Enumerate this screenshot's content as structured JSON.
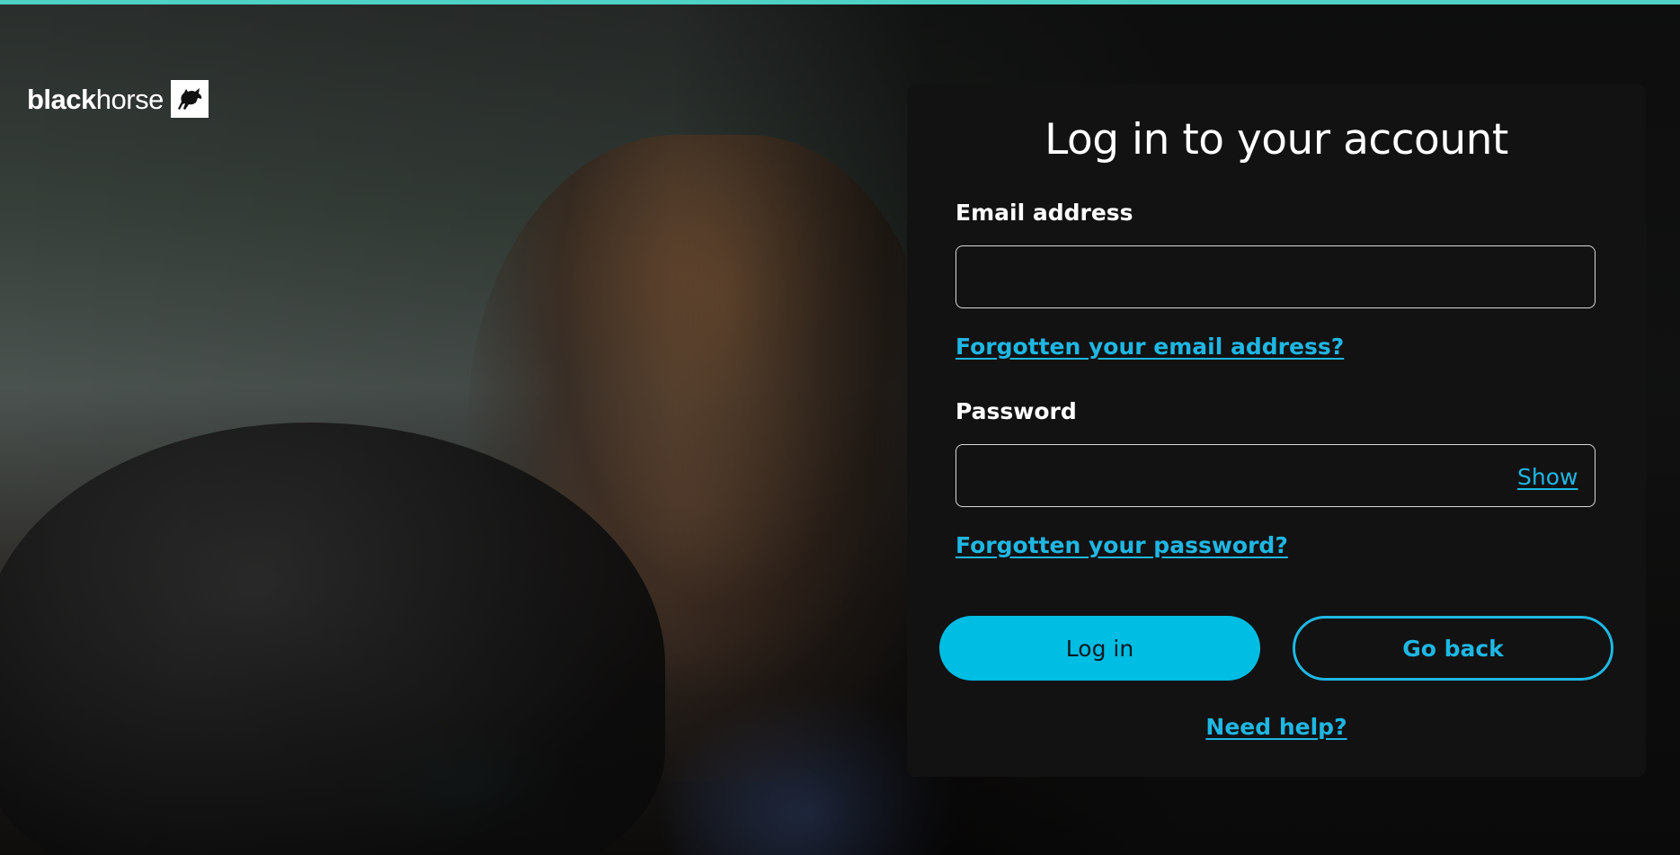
{
  "brand": {
    "logo_bold": "black",
    "logo_regular": "horse",
    "badge_icon": "horse-icon",
    "accent_color": "#4fd1c5",
    "link_color": "#1fb7e3",
    "primary_button_color": "#00bde3"
  },
  "login_form": {
    "title": "Log in to your account",
    "email_label": "Email address",
    "email_value": "",
    "forgot_email_link": "Forgotten your email address?",
    "password_label": "Password",
    "password_value": "",
    "show_password_label": "Show",
    "forgot_password_link": "Forgotten your password?",
    "login_button": "Log in",
    "go_back_button": "Go back",
    "help_link": "Need help?"
  }
}
